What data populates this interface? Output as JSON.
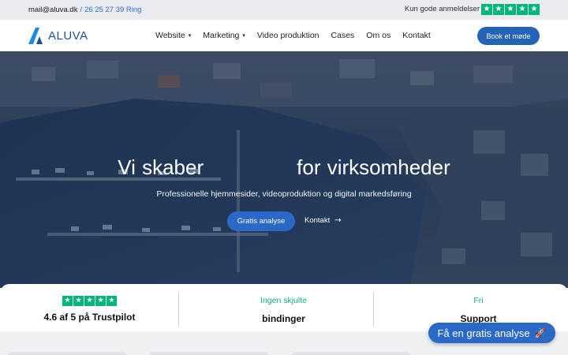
{
  "topbar": {
    "email": "mail@aluva.dk",
    "separator": "/",
    "phone": "26 25 27 39 Ring",
    "review_text": "Kun gode anmeldelser",
    "star_glyph": "★"
  },
  "nav": {
    "logo_text": "ALUVA",
    "items": [
      {
        "label": "Website",
        "has_dropdown": true
      },
      {
        "label": "Marketing",
        "has_dropdown": true
      },
      {
        "label": "Video produktion",
        "has_dropdown": false
      },
      {
        "label": "Cases",
        "has_dropdown": false
      },
      {
        "label": "Om os",
        "has_dropdown": false
      },
      {
        "label": "Kontakt",
        "has_dropdown": false
      }
    ],
    "chevron_glyph": "▾",
    "book_button": "Book et møde"
  },
  "hero": {
    "title_start": "Vi skaber",
    "title_end": "for virksomheder",
    "subtitle": "Professionelle hjemmesider, videoproduktion og digital markedsføring",
    "primary_button": "Gratis analyse",
    "secondary_link": "Kontakt",
    "arrow_glyph": "→"
  },
  "stats": {
    "trustpilot": {
      "rating_text": "4.6 af 5 på Trustpilot",
      "stars": 5
    },
    "hidden": {
      "small": "Ingen skjulte",
      "big": "bindinger"
    },
    "support": {
      "small": "Fri",
      "big": "Support"
    }
  },
  "cta": {
    "label": "Få en gratis analyse",
    "rocket_glyph": "🚀"
  },
  "colors": {
    "brand_blue": "#2363b8",
    "trustpilot_green": "#00b67a",
    "accent_green": "#10b06b"
  }
}
